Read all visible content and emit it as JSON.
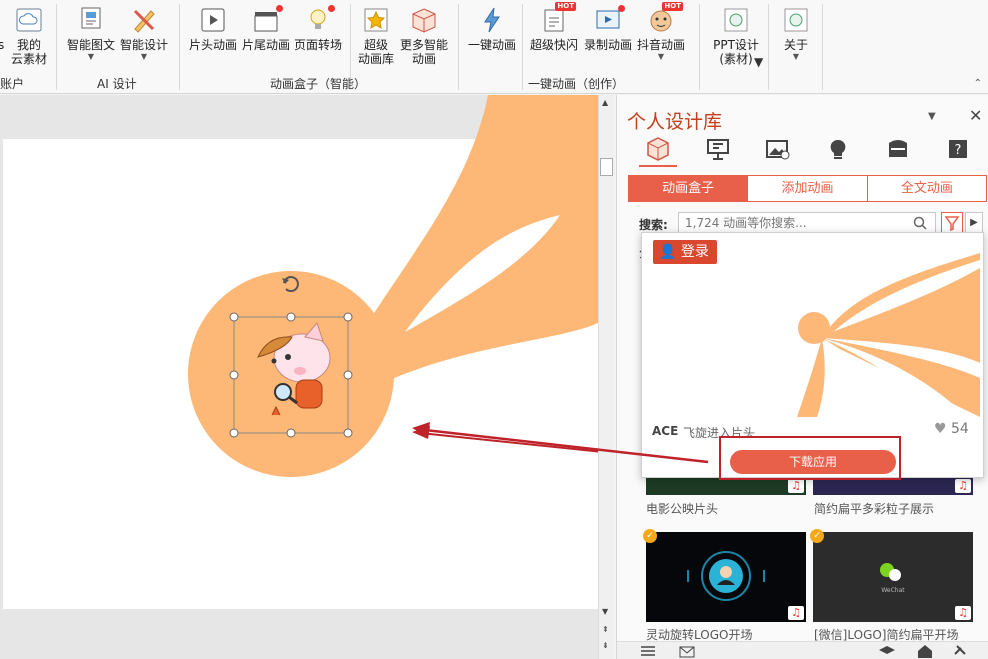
{
  "ribbon": {
    "account_partial": "s",
    "account_label_partial": "账户",
    "my_materials": [
      "我的",
      "云素材"
    ],
    "smart_graphic": "智能图文",
    "smart_design": "智能设计",
    "ai_group": "AI 设计",
    "intro_anim": "片头动画",
    "outro_anim": "片尾动画",
    "page_transition": "页面转场",
    "super_lib": [
      "超级",
      "动画库"
    ],
    "more_smart": [
      "更多智能",
      "动画"
    ],
    "box_group": "动画盒子（智能）",
    "one_click": "一键动画",
    "super_flash": "超级快闪",
    "record_anim": "录制动画",
    "douyin_anim": "抖音动画",
    "create_group": "一键动画（创作）",
    "ppt_design": [
      "PPT设计",
      "(素材)"
    ],
    "about": "关于",
    "hot_badge": "HOT"
  },
  "panel": {
    "title": "个人设计库",
    "tabs": [
      "动画盒子",
      "添加动画",
      "全文动画"
    ],
    "search_label": "搜索:",
    "search_placeholder": "1,724 动画等你搜索...",
    "row_fragment": "分",
    "items": [
      {
        "caption": "电影公映片头"
      },
      {
        "caption": "简约扁平多彩粒子展示"
      },
      {
        "caption": "灵动旋转LOGO开场"
      },
      {
        "caption": "[微信]LOGO]简约扁平开场"
      }
    ],
    "wechat_label": "WeChat"
  },
  "popup": {
    "login": "登录",
    "author": "ACE",
    "name": "飞旋进入片头",
    "likes": "54",
    "download": "下载应用"
  },
  "colors": {
    "accent": "#e8604a",
    "orange": "#fdb877",
    "title_red": "#c43e1c",
    "annotation_red": "#c0222a"
  }
}
